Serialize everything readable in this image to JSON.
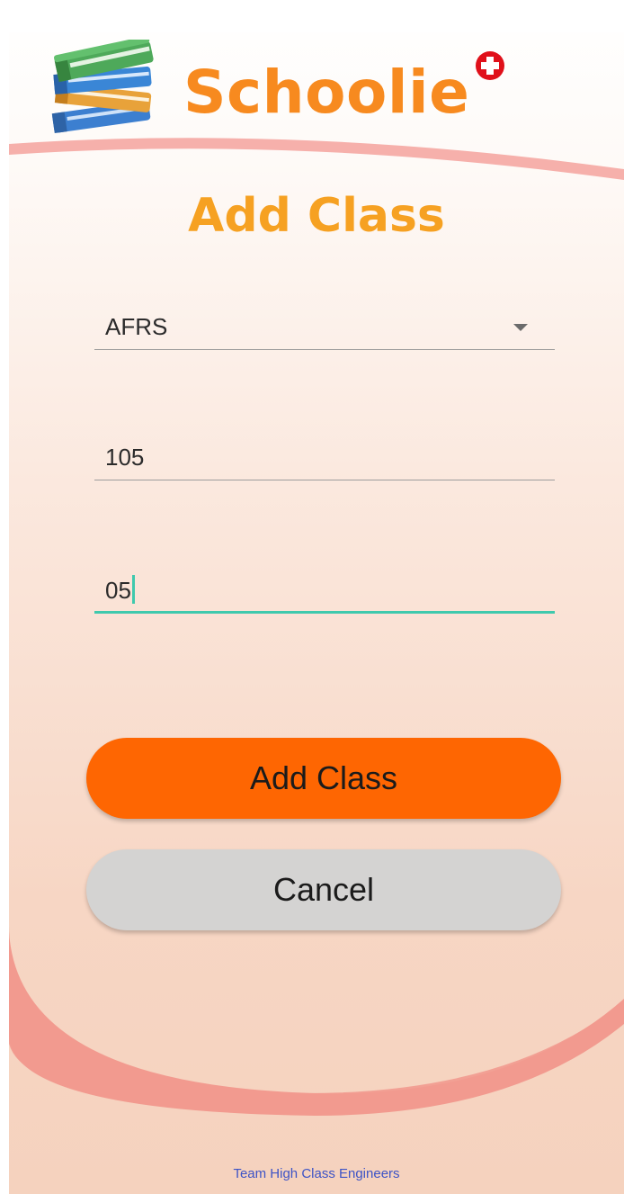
{
  "app": {
    "title": "Schoolie"
  },
  "icons": {
    "logo": "books-stack-icon",
    "badge": "plus-badge-icon",
    "dropdown": "dropdown-arrow-icon"
  },
  "page": {
    "title": "Add Class"
  },
  "form": {
    "department_value": "AFRS",
    "course_number_value": "105",
    "section_value": "05"
  },
  "buttons": {
    "add_label": "Add Class",
    "cancel_label": "Cancel"
  },
  "footer": {
    "text": "Team High Class Engineers"
  },
  "colors": {
    "title_orange": "#f78a1f",
    "heading_orange": "#f6a122",
    "primary_button": "#fe6602",
    "secondary_button": "#d4d3d2",
    "focus_underline": "#3fc9ad",
    "badge_red": "#e0101a",
    "footer_text": "#3d53c6",
    "wave": "#f29a8f"
  }
}
